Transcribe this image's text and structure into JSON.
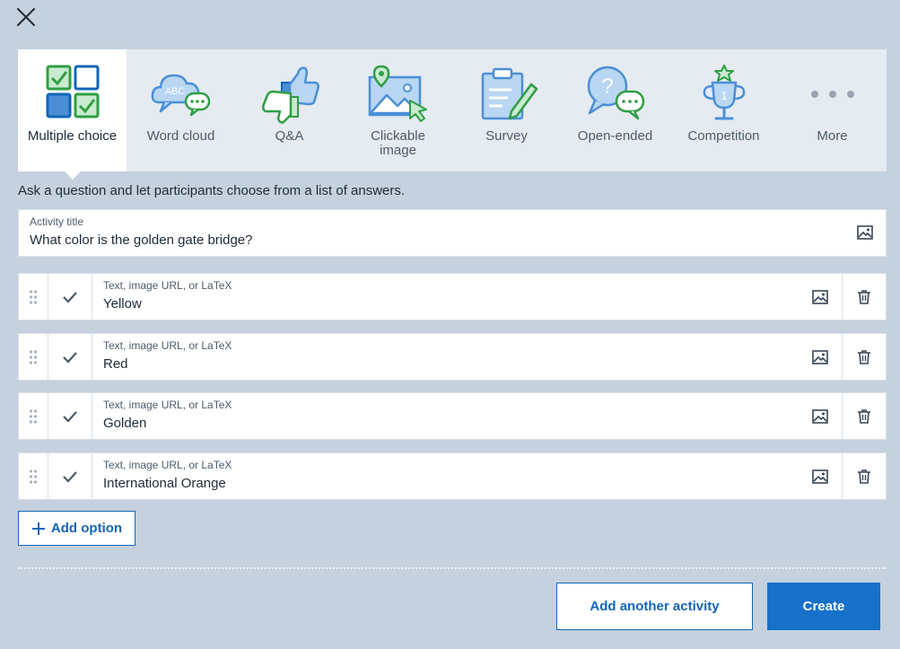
{
  "types": [
    {
      "label": "Multiple choice",
      "icon": "multiple-choice-icon",
      "active": true
    },
    {
      "label": "Word cloud",
      "icon": "word-cloud-icon",
      "active": false
    },
    {
      "label": "Q&A",
      "icon": "thumbs-icon",
      "active": false
    },
    {
      "label": "Clickable image",
      "icon": "clickable-image-icon",
      "active": false
    },
    {
      "label": "Survey",
      "icon": "survey-icon",
      "active": false
    },
    {
      "label": "Open-ended",
      "icon": "open-ended-icon",
      "active": false
    },
    {
      "label": "Competition",
      "icon": "trophy-icon",
      "active": false
    },
    {
      "label": "More",
      "icon": "more-icon",
      "active": false
    }
  ],
  "word_cloud_badge": "ABC",
  "competition_badge": "1",
  "description": "Ask a question and let participants choose from a list of answers.",
  "title_field": {
    "label": "Activity title",
    "value": "What color is the golden gate bridge?"
  },
  "options": [
    {
      "placeholder": "Text, image URL, or LaTeX",
      "value": "Yellow"
    },
    {
      "placeholder": "Text, image URL, or LaTeX",
      "value": "Red"
    },
    {
      "placeholder": "Text, image URL, or LaTeX",
      "value": "Golden"
    },
    {
      "placeholder": "Text, image URL, or LaTeX",
      "value": "International Orange"
    }
  ],
  "add_option_label": "Add option",
  "add_another_label": "Add another activity",
  "create_label": "Create",
  "colors": {
    "background": "#c5d1de",
    "accent": "#1770c9",
    "green": "#2f9e44",
    "icon_blue": "#4a8fd6",
    "icon_fill": "#b9d6f2"
  }
}
